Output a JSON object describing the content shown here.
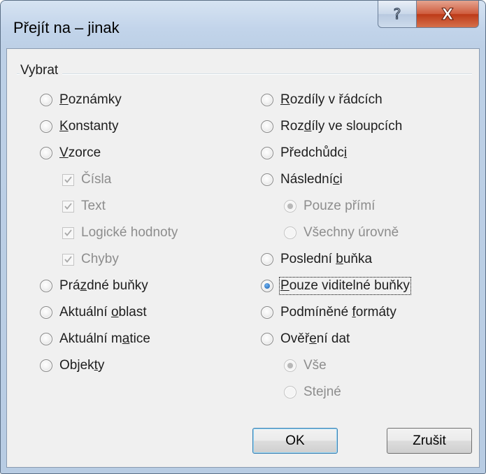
{
  "window": {
    "title": "Přejít na – jinak",
    "help_label": "?",
    "close_label": "X"
  },
  "group": {
    "label": "Vybrat"
  },
  "left": [
    {
      "pre": "",
      "u": "P",
      "post": "oznámky",
      "kind": "radio",
      "checked": false,
      "enabled": true
    },
    {
      "pre": "",
      "u": "K",
      "post": "onstanty",
      "kind": "radio",
      "checked": false,
      "enabled": true
    },
    {
      "pre": "",
      "u": "V",
      "post": "zorce",
      "kind": "radio",
      "checked": false,
      "enabled": true
    },
    {
      "pre": "Čísla",
      "u": "",
      "post": "",
      "kind": "checkbox",
      "checked": true,
      "enabled": false
    },
    {
      "pre": "Text",
      "u": "",
      "post": "",
      "kind": "checkbox",
      "checked": true,
      "enabled": false
    },
    {
      "pre": "Logické hodnoty",
      "u": "",
      "post": "",
      "kind": "checkbox",
      "checked": true,
      "enabled": false
    },
    {
      "pre": "Chyby",
      "u": "",
      "post": "",
      "kind": "checkbox",
      "checked": true,
      "enabled": false
    },
    {
      "pre": "Prá",
      "u": "z",
      "post": "dné buňky",
      "kind": "radio",
      "checked": false,
      "enabled": true
    },
    {
      "pre": "Aktuální ",
      "u": "o",
      "post": "blast",
      "kind": "radio",
      "checked": false,
      "enabled": true
    },
    {
      "pre": "Aktuální m",
      "u": "a",
      "post": "tice",
      "kind": "radio",
      "checked": false,
      "enabled": true
    },
    {
      "pre": "Objek",
      "u": "t",
      "post": "y",
      "kind": "radio",
      "checked": false,
      "enabled": true
    }
  ],
  "right": [
    {
      "pre": "",
      "u": "R",
      "post": "ozdíly v řádcích",
      "kind": "radio",
      "checked": false,
      "enabled": true
    },
    {
      "pre": "Roz",
      "u": "d",
      "post": "íly ve sloupcích",
      "kind": "radio",
      "checked": false,
      "enabled": true
    },
    {
      "pre": "Předchůdc",
      "u": "i",
      "post": "",
      "kind": "radio",
      "checked": false,
      "enabled": true
    },
    {
      "pre": "Následní",
      "u": "c",
      "post": "i",
      "kind": "radio",
      "checked": false,
      "enabled": true
    },
    {
      "pre": "Pouze přímí",
      "u": "",
      "post": "",
      "kind": "radio",
      "checked": true,
      "enabled": false
    },
    {
      "pre": "Všechny úrovně",
      "u": "",
      "post": "",
      "kind": "radio",
      "checked": false,
      "enabled": false
    },
    {
      "pre": "Poslední ",
      "u": "b",
      "post": "uňka",
      "kind": "radio",
      "checked": false,
      "enabled": true
    },
    {
      "pre": "",
      "u": "P",
      "post": "ouze viditelné buňky",
      "kind": "radio",
      "checked": true,
      "enabled": true
    },
    {
      "pre": "Podmíněné ",
      "u": "f",
      "post": "ormáty",
      "kind": "radio",
      "checked": false,
      "enabled": true
    },
    {
      "pre": "Ověř",
      "u": "e",
      "post": "ní dat",
      "kind": "radio",
      "checked": false,
      "enabled": true
    },
    {
      "pre": "Vše",
      "u": "",
      "post": "",
      "kind": "radio",
      "checked": true,
      "enabled": false
    },
    {
      "pre": "Stejné",
      "u": "",
      "post": "",
      "kind": "radio",
      "checked": false,
      "enabled": false
    }
  ],
  "buttons": {
    "ok": "OK",
    "cancel": "Zrušit"
  },
  "colors": {
    "titlebar": "#c2d4ea",
    "close": "#c8472a",
    "client": "#f0f0f0",
    "selected_radio": "#1a5fb0"
  }
}
